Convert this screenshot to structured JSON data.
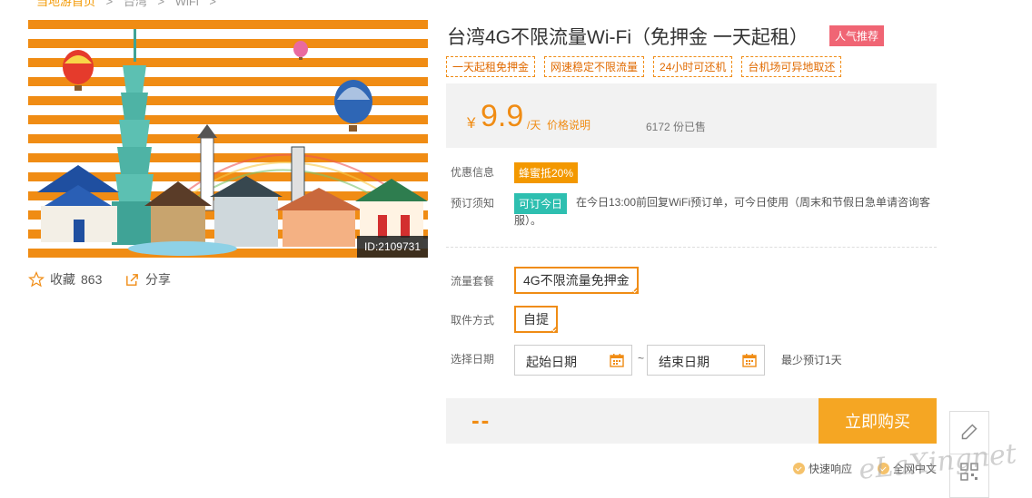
{
  "breadcrumb": [
    "当地游首页",
    "台湾",
    "WiFi"
  ],
  "product": {
    "id_label": "ID:2109731",
    "title": "台湾4G不限流量Wi-Fi（免押金 一天起租）",
    "badge": "人气推荐",
    "tags": [
      "一天起租免押金",
      "网速稳定不限流量",
      "24小时可还机",
      "台机场可异地取还"
    ]
  },
  "actions": {
    "favorite_label": "收藏",
    "favorite_count": "863",
    "share_label": "分享"
  },
  "price": {
    "currency": "¥",
    "amount": "9.9",
    "unit": "/天",
    "note_link": "价格说明",
    "sold": "6172 份已售"
  },
  "info": {
    "discount_label": "优惠信息",
    "discount_badge": "蜂蜜抵20%",
    "booking_label": "预订须知",
    "booking_badge": "可订今日",
    "booking_text": "在今日13:00前回复WiFi预订单，可今日使用（周末和节假日急单请咨询客服）。"
  },
  "options": {
    "plan_label": "流量套餐",
    "plan_value": "4G不限流量免押金",
    "pickup_label": "取件方式",
    "pickup_value": "自提",
    "date_label": "选择日期",
    "start_date": "起始日期",
    "end_date": "结束日期",
    "separator": "~",
    "min_note": "最少预订1天"
  },
  "purchase": {
    "total": "--",
    "buy_label": "立即购买"
  },
  "services": [
    "快速响应",
    "全网中文"
  ],
  "watermark": "eLaXingnet",
  "colors": {
    "accent": "#f08c14",
    "buy": "#f5a623",
    "badge_hot": "#f06574",
    "badge_today": "#2ebfb0"
  }
}
